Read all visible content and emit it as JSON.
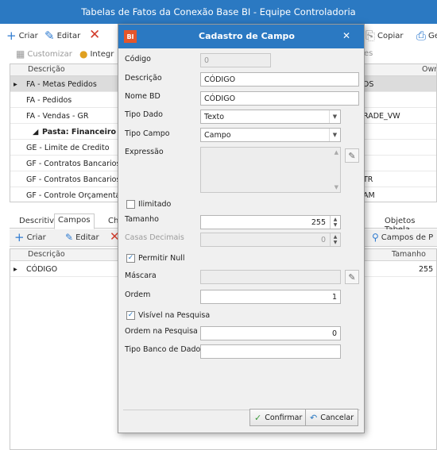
{
  "window": {
    "title": "Tabelas de Fatos da Conexão Base BI - Equipe Controladoria"
  },
  "main_toolbar": {
    "criar": "Criar",
    "editar": "Editar",
    "copiar": "Copiar",
    "ge": "Ge",
    "customizar": "Customizar",
    "integr": "Integr",
    "es": "es"
  },
  "top_grid": {
    "headers": {
      "descricao": "Descrição",
      "own": "Own"
    },
    "rows": [
      {
        "desc": "FA - Metas Pedidos",
        "right": "DS"
      },
      {
        "desc": "FA - Pedidos",
        "right": ""
      },
      {
        "desc": "FA - Vendas - GR",
        "right": "RADE_VW"
      },
      {
        "desc": "Pasta: Financeiro",
        "right": ""
      },
      {
        "desc": "GE - Limite de Credito",
        "right": ""
      },
      {
        "desc": "GF - Contratos Bancarios",
        "right": ""
      },
      {
        "desc": "GF - Contratos Bancarios P",
        "right": "TR"
      },
      {
        "desc": "GF - Controle Orçamentário",
        "right": "AM"
      }
    ]
  },
  "bottom_tabs": {
    "descritivo": "Descritivo",
    "campos": "Campos",
    "ch": "Ch",
    "objetos_tabela": "Objetos Tabela"
  },
  "bottom_toolbar": {
    "criar": "Criar",
    "editar": "Editar",
    "campos_de": "Campos de P"
  },
  "bottom_grid": {
    "headers": {
      "descricao": "Descrição",
      "tamanho": "Tamanho"
    },
    "row": {
      "desc": "CÓDIGO",
      "tamanho": "255"
    }
  },
  "dialog": {
    "logo": "BI",
    "title": "Cadastro de Campo",
    "close": "✕",
    "codigo_label": "Código",
    "codigo_value": "0",
    "descricao_label": "Descrição",
    "descricao_value": "CÓDIGO",
    "nome_bd_label": "Nome BD",
    "nome_bd_value": "CÓDIGO",
    "tipo_dado_label": "Tipo Dado",
    "tipo_dado_value": "Texto",
    "tipo_campo_label": "Tipo Campo",
    "tipo_campo_value": "Campo",
    "expressao_label": "Expressão",
    "expressao_value": "",
    "ilimitado_label": "Ilimitado",
    "ilimitado_checked": false,
    "tamanho_label": "Tamanho",
    "tamanho_value": "255",
    "casas_decimais_label": "Casas Decimais",
    "casas_decimais_value": "0",
    "permitir_null_label": "Permitir Null",
    "permitir_null_checked": true,
    "mascara_label": "Máscara",
    "mascara_value": "",
    "ordem_label": "Ordem",
    "ordem_value": "1",
    "visivel_label": "Visível na Pesquisa",
    "visivel_checked": true,
    "ordem_pesquisa_label": "Ordem na Pesquisa",
    "ordem_pesquisa_value": "0",
    "tipo_banco_label": "Tipo Banco de Dados",
    "tipo_banco_value": "",
    "confirmar": "Confirmar",
    "cancelar": "Cancelar"
  },
  "colors": {
    "title_bar": "#2b79c2",
    "accent_red": "#d23c2c",
    "accent_blue": "#2f7bd0"
  }
}
